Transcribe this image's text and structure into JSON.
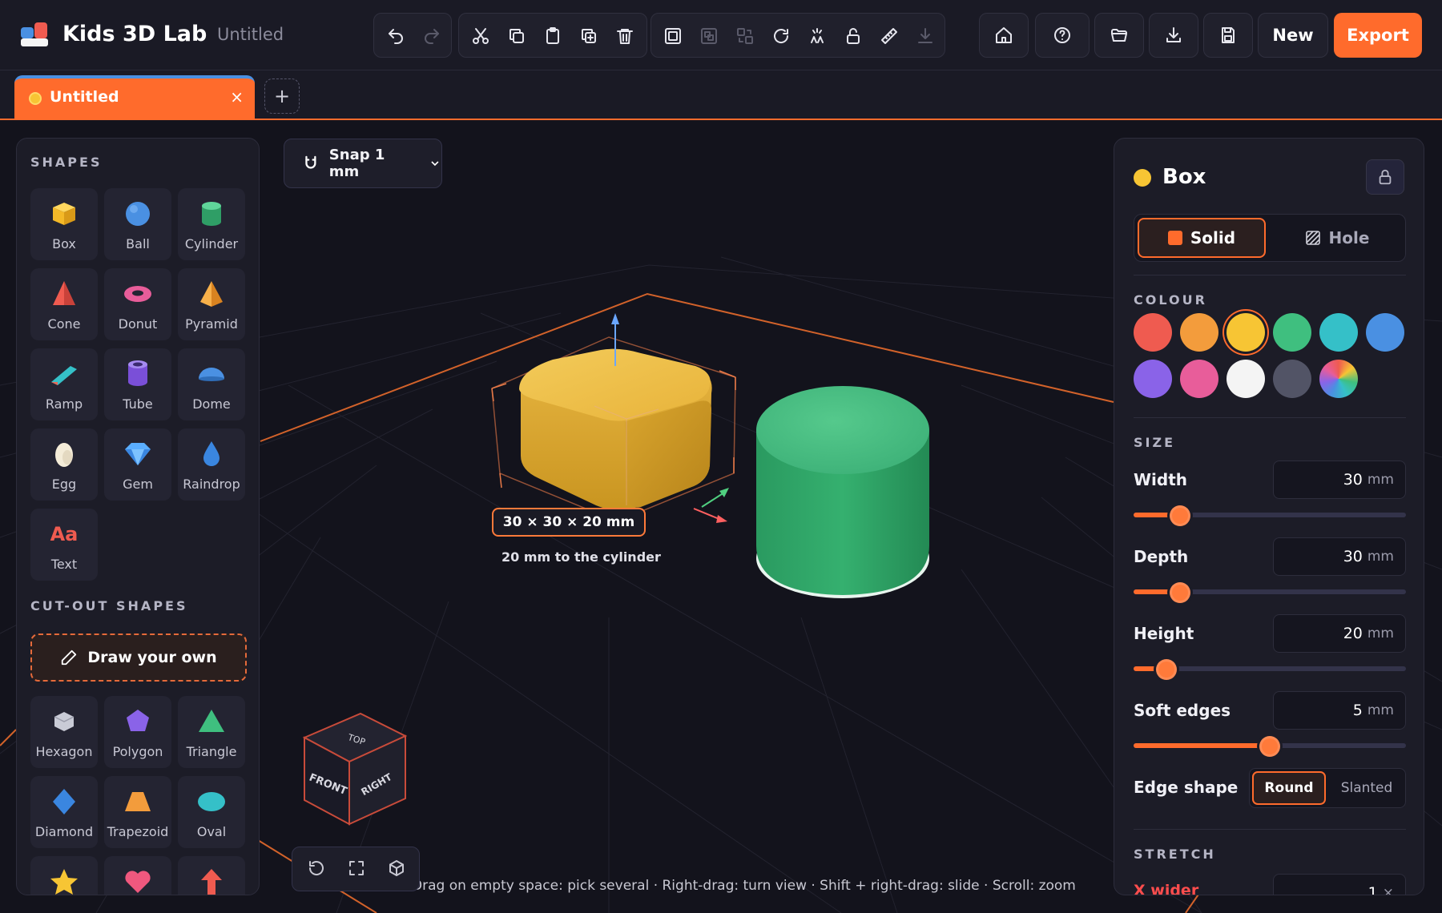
{
  "app": {
    "title": "Kids 3D Lab",
    "document_name": "Untitled"
  },
  "toolbar": {
    "edit_tools": [
      {
        "name": "undo-icon",
        "enabled": true
      },
      {
        "name": "redo-icon",
        "enabled": false
      }
    ],
    "clipboard_tools": [
      "cut-icon",
      "copy-icon",
      "paste-icon",
      "duplicate-icon",
      "delete-icon"
    ],
    "arrange_tools": [
      "group-icon",
      "ungroup-icon",
      "align-icon",
      "rotate-icon",
      "flip-icon",
      "unlock-icon",
      "measure-icon",
      "drop-icon"
    ],
    "nav_buttons": [
      "home-icon",
      "help-icon",
      "open-folder-icon",
      "import-icon",
      "save-icon"
    ],
    "new_label": "New",
    "export_label": "Export"
  },
  "tabs": [
    {
      "label": "Untitled",
      "close": "×"
    }
  ],
  "tab_add_label": "+",
  "left_panel": {
    "shapes_title": "SHAPES",
    "shapes": [
      {
        "label": "Box",
        "icon": "box-icon",
        "color": "#f7c534"
      },
      {
        "label": "Ball",
        "icon": "ball-icon",
        "color": "#4a90e2"
      },
      {
        "label": "Cylinder",
        "icon": "cylinder-icon",
        "color": "#3fbf7f"
      },
      {
        "label": "Cone",
        "icon": "cone-icon",
        "color": "#ef5b50"
      },
      {
        "label": "Donut",
        "icon": "donut-icon",
        "color": "#e85d9a"
      },
      {
        "label": "Pyramid",
        "icon": "pyramid-icon",
        "color": "#f39c3c"
      },
      {
        "label": "Ramp",
        "icon": "ramp-icon",
        "color": "#35c0c8"
      },
      {
        "label": "Tube",
        "icon": "tube-icon",
        "color": "#8a63e8"
      },
      {
        "label": "Dome",
        "icon": "dome-icon",
        "color": "#4a90e2"
      },
      {
        "label": "Egg",
        "icon": "egg-icon",
        "color": "#f4ecd8"
      },
      {
        "label": "Gem",
        "icon": "gem-icon",
        "color": "#5aaeff"
      },
      {
        "label": "Raindrop",
        "icon": "raindrop-icon",
        "color": "#3a86e0"
      },
      {
        "label": "Text",
        "icon": "text-icon",
        "color": "#ef5b50",
        "glyph": "Aa"
      }
    ],
    "cutout_title": "CUT-OUT SHAPES",
    "draw_label": "Draw your own",
    "cutouts": [
      {
        "label": "Hexagon",
        "icon": "hexagon-icon",
        "color": "#c9cbd6"
      },
      {
        "label": "Polygon",
        "icon": "polygon-icon",
        "color": "#8a63e8"
      },
      {
        "label": "Triangle",
        "icon": "triangle-icon",
        "color": "#3fbf7f"
      },
      {
        "label": "Diamond",
        "icon": "diamond-icon",
        "color": "#3a86e0"
      },
      {
        "label": "Trapezoid",
        "icon": "trapezoid-icon",
        "color": "#f39c3c"
      },
      {
        "label": "Oval",
        "icon": "oval-icon",
        "color": "#35c0c8"
      },
      {
        "label": "",
        "icon": "star-icon",
        "color": "#f7c534"
      },
      {
        "label": "",
        "icon": "heart-icon",
        "color": "#f0587e"
      },
      {
        "label": "",
        "icon": "arrow-icon",
        "color": "#ef5b50"
      }
    ]
  },
  "viewport": {
    "snap_label": "Snap 1 mm",
    "dimension_label": "30 × 30 × 20 mm",
    "distance_label": "20 mm to the cylinder",
    "hint": "Drag on empty space: pick several · Right-drag: turn view · Shift + right-drag: slide · Scroll: zoom",
    "view_cube": {
      "top": "TOP",
      "front": "FRONT",
      "right": "RIGHT"
    },
    "view_tools": [
      "reset-view-icon",
      "fit-view-icon",
      "perspective-icon"
    ]
  },
  "right_panel": {
    "title": "Box",
    "title_color": "#f7c534",
    "mode": {
      "solid_label": "Solid",
      "hole_label": "Hole",
      "selected": "Solid"
    },
    "colour_title": "COLOUR",
    "colours": [
      "#ef5b50",
      "#f39c3c",
      "#f7c534",
      "#3fbf7f",
      "#35c0c8",
      "#4a90e2",
      "#8a63e8",
      "#e85d9a",
      "#f4f4f4",
      "#525466",
      "rainbow"
    ],
    "selected_colour": "#f7c534",
    "size_title": "SIZE",
    "fields": [
      {
        "label": "Width",
        "value": "30",
        "unit": "mm",
        "level": 0.17
      },
      {
        "label": "Depth",
        "value": "30",
        "unit": "mm",
        "level": 0.17
      },
      {
        "label": "Height",
        "value": "20",
        "unit": "mm",
        "level": 0.12
      },
      {
        "label": "Soft edges",
        "value": "5",
        "unit": "mm",
        "level": 0.5
      }
    ],
    "edge_shape_label": "Edge shape",
    "edge_round_label": "Round",
    "edge_slanted_label": "Slanted",
    "stretch_title": "STRETCH",
    "stretch_x_label": "X wider",
    "stretch_x_value": "1",
    "stretch_x_unit": "×"
  },
  "accent_color": "#ff6b2c"
}
